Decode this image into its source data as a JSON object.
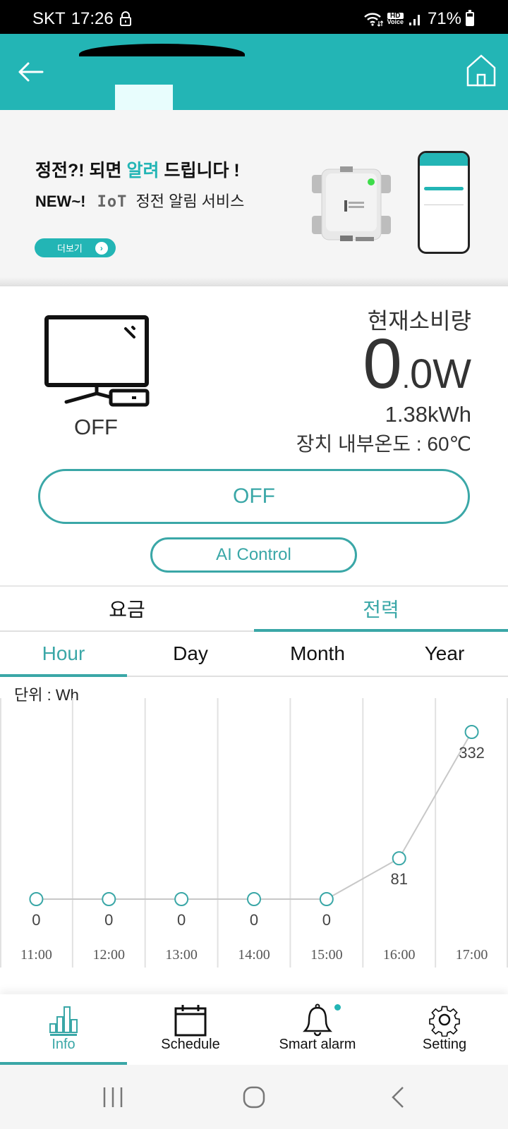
{
  "status_bar": {
    "carrier": "SKT",
    "time": "17:26",
    "hd_label": "HD",
    "voice_label": "Voice",
    "battery": "71%",
    "icons": [
      "lock-icon",
      "wifi-icon",
      "hd-voice-icon",
      "signal-icon",
      "battery-icon"
    ]
  },
  "header": {
    "title": "",
    "back_icon": "back-arrow-icon",
    "home_icon": "home-icon"
  },
  "banner": {
    "title_part1": "정전?! 되면 ",
    "title_highlight": "알려",
    "title_part2": " 드립니다 !",
    "sub_new": "NEW~!",
    "sub_iot": "IoT",
    "sub_text": "정전 알림 서비스",
    "more_label": "더보기",
    "more_icon": "chevron-right-icon",
    "accent": "#23b5b5"
  },
  "device": {
    "icon": "tv-icon",
    "state": "OFF",
    "usage_label": "현재소비량",
    "usage_int": "0",
    "usage_dec": "0",
    "usage_unit": "W",
    "energy_total": "1.38kWh",
    "temp_label": "장치 내부온도 : 60℃"
  },
  "controls": {
    "power_label": "OFF",
    "ai_label": "AI Control"
  },
  "tabs_main": [
    {
      "label": "요금",
      "active": false
    },
    {
      "label": "전력",
      "active": true
    }
  ],
  "tabs_sub": [
    {
      "label": "Hour",
      "active": true
    },
    {
      "label": "Day",
      "active": false
    },
    {
      "label": "Month",
      "active": false
    },
    {
      "label": "Year",
      "active": false
    }
  ],
  "unit_label": "단위 : Wh",
  "chart_data": {
    "type": "line",
    "title": "",
    "xlabel": "",
    "ylabel": "Wh",
    "categories": [
      "11:00",
      "12:00",
      "13:00",
      "14:00",
      "15:00",
      "16:00",
      "17:00"
    ],
    "values": [
      0,
      0,
      0,
      0,
      0,
      81,
      332
    ],
    "data_labels": [
      "0",
      "0",
      "0",
      "0",
      "0",
      "81",
      "332"
    ],
    "ylim": [
      0,
      332
    ],
    "grid": "vertical",
    "legend": "none",
    "line_color": "#c8c8c8",
    "marker_color": "#3aa7a7"
  },
  "bottom_nav": [
    {
      "label": "Info",
      "icon": "bar-chart-icon",
      "active": true
    },
    {
      "label": "Schedule",
      "icon": "calendar-icon",
      "active": false
    },
    {
      "label": "Smart alarm",
      "icon": "bell-icon",
      "active": false,
      "badge": true
    },
    {
      "label": "Setting",
      "icon": "gear-icon",
      "active": false
    }
  ],
  "system_nav": [
    "recent-apps-icon",
    "home-circle-icon",
    "back-chevron-icon"
  ]
}
